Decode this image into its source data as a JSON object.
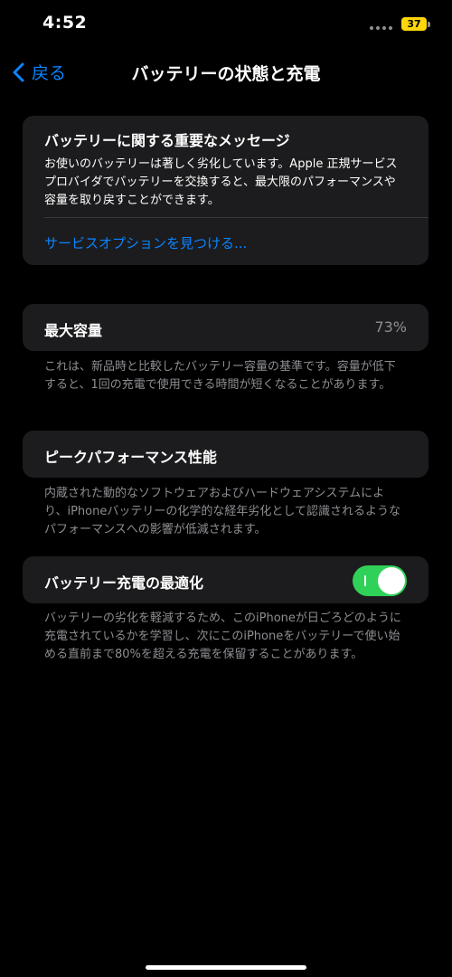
{
  "status_bar": {
    "time": "4:52",
    "battery_level": "37",
    "battery_color": "#ffd60a"
  },
  "nav": {
    "back_label": "戻る",
    "title": "バッテリーの状態と充電"
  },
  "important_message": {
    "title": "バッテリーに関する重要なメッセージ",
    "body": "お使いのバッテリーは著しく劣化しています。Apple 正規サービスプロバイダでバッテリーを交換すると、最大限のパフォーマンスや容量を取り戻すことができます。",
    "link": "サービスオプションを見つける..."
  },
  "max_capacity": {
    "label": "最大容量",
    "value": "73%",
    "footnote": "これは、新品時と比較したバッテリー容量の基準です。容量が低下すると、1回の充電で使用できる時間が短くなることがあります。"
  },
  "peak_performance": {
    "label": "ピークパフォーマンス性能",
    "footnote": "内蔵された動的なソフトウェアおよびハードウェアシステムにより、iPhoneバッテリーの化学的な経年劣化として認識されるようなパフォーマンスへの影響が低減されます。"
  },
  "optimized_charging": {
    "label": "バッテリー充電の最適化",
    "enabled": true,
    "footnote": "バッテリーの劣化を軽減するため、このiPhoneが日ごろどのように充電されているかを学習し、次にこのiPhoneをバッテリーで使い始める直前まで80%を超える充電を保留することがあります。"
  },
  "colors": {
    "accent": "#0a84ff",
    "toggle_on": "#30d158",
    "card_bg": "#1c1c1e",
    "secondary_text": "#8e8e93"
  }
}
